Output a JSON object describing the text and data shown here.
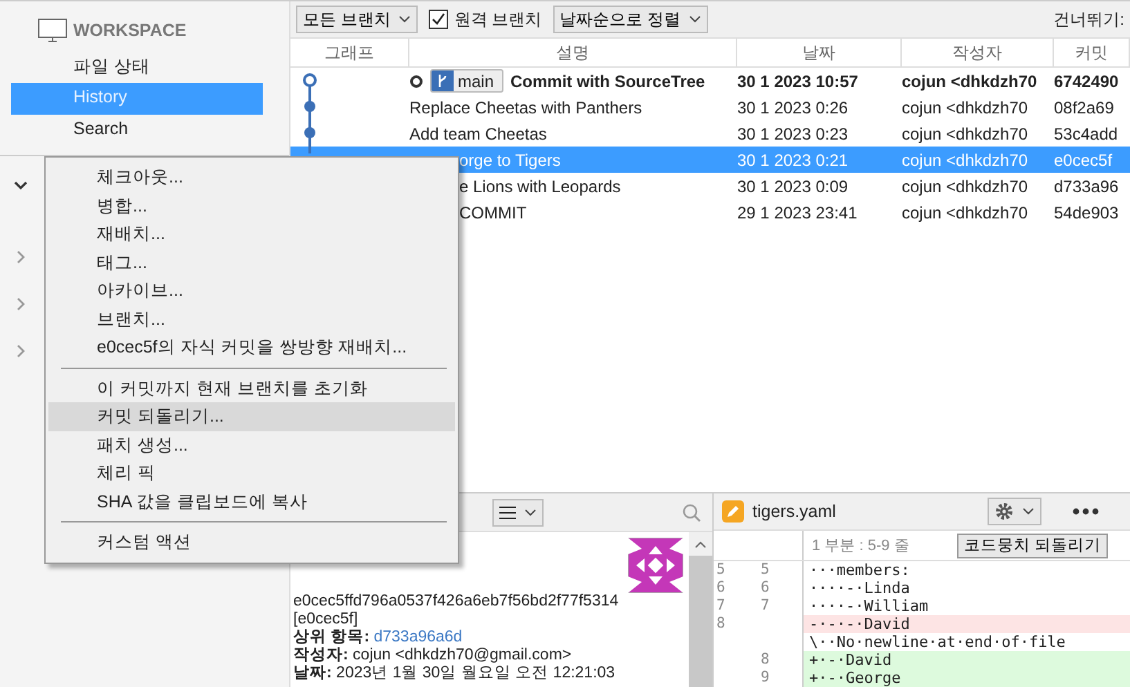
{
  "sidebar": {
    "workspace_title": "WORKSPACE",
    "items": [
      {
        "label": "파일 상태",
        "selected": false
      },
      {
        "label": "History",
        "selected": true
      },
      {
        "label": "Search",
        "selected": false
      }
    ],
    "collapsed_sections": [
      {
        "expanded": true
      },
      {
        "expanded": false
      },
      {
        "expanded": false
      },
      {
        "expanded": false
      }
    ]
  },
  "toolbar": {
    "branch_filter": "모든 브랜치",
    "remote_branches": {
      "label": "원격 브랜치",
      "checked": true
    },
    "sort": "날짜순으로 정렬",
    "jump_label": "건너뛰기:"
  },
  "table": {
    "columns": [
      "그래프",
      "설명",
      "날짜",
      "작성자",
      "커밋"
    ],
    "rows": [
      {
        "description": "Commit with SourceTree",
        "branch": "main",
        "date": "30 1 2023 10:57",
        "author": "cojun <dhkdzh70",
        "commit": "6742490",
        "head": true,
        "selected": false
      },
      {
        "description": "Replace Cheetas with Panthers",
        "date": "30 1 2023 0:26",
        "author": "cojun <dhkdzh70",
        "commit": "08f2a69",
        "head": false,
        "selected": false
      },
      {
        "description": "Add team Cheetas",
        "date": "30 1 2023 0:23",
        "author": "cojun <dhkdzh70",
        "commit": "53c4add",
        "head": false,
        "selected": false
      },
      {
        "description": "orge to Tigers",
        "date": "30 1 2023 0:21",
        "author": "cojun <dhkdzh70",
        "commit": "e0cec5f",
        "head": false,
        "selected": true
      },
      {
        "description": "e Lions with Leopards",
        "date": "30 1 2023 0:09",
        "author": "cojun <dhkdzh70",
        "commit": "d733a96",
        "head": false,
        "selected": false
      },
      {
        "description": "COMMIT",
        "date": "29 1 2023 23:41",
        "author": "cojun <dhkdzh70",
        "commit": "54de903",
        "head": false,
        "selected": false
      }
    ]
  },
  "context_menu": [
    {
      "kind": "item",
      "label": "체크아웃...",
      "selected": false
    },
    {
      "kind": "item",
      "label": "병합...",
      "selected": false
    },
    {
      "kind": "item",
      "label": "재배치...",
      "selected": false
    },
    {
      "kind": "item",
      "label": "태그...",
      "selected": false
    },
    {
      "kind": "item",
      "label": "아카이브...",
      "selected": false
    },
    {
      "kind": "item",
      "label": "브랜치...",
      "selected": false
    },
    {
      "kind": "item",
      "label": "e0cec5f의 자식 커밋을 쌍방향 재배치...",
      "selected": false
    },
    {
      "kind": "separator"
    },
    {
      "kind": "item",
      "label": "이 커밋까지 현재 브랜치를 초기화",
      "selected": false
    },
    {
      "kind": "item",
      "label": "커밋 되돌리기...",
      "selected": true
    },
    {
      "kind": "item",
      "label": "패치 생성...",
      "selected": false
    },
    {
      "kind": "item",
      "label": "체리 픽",
      "selected": false
    },
    {
      "kind": "item",
      "label": "SHA 값을 클립보드에 복사",
      "selected": false
    },
    {
      "kind": "separator"
    },
    {
      "kind": "item",
      "label": "커스텀 액션",
      "selected": false
    }
  ],
  "commit_details": {
    "sha": "e0cec5ffd796a0537f426a6eb7f56bd2f77f5314",
    "short_sha": "[e0cec5f]",
    "fields": [
      {
        "label": "상위 항목:",
        "value": "d733a96a6d",
        "kind": "link"
      },
      {
        "label": "작성자:",
        "value": "cojun <dhkdzh70@gmail.com>",
        "kind": "text"
      },
      {
        "label": "날짜:",
        "value": "2023년 1월 30일 월요일 오전 12:21:03",
        "kind": "text"
      }
    ]
  },
  "diff": {
    "file_name": "tigers.yaml",
    "hunk_header": "1 부분 : 5-9 줄",
    "discard_hunk_button": "코드뭉치 되돌리기",
    "lines": [
      {
        "old": "5",
        "new": "5",
        "text": "···members:",
        "kind": "context"
      },
      {
        "old": "6",
        "new": "6",
        "text": "····-·Linda",
        "kind": "context"
      },
      {
        "old": "7",
        "new": "7",
        "text": "····-·William",
        "kind": "context"
      },
      {
        "old": "8",
        "text": "-·-·-·David",
        "kind": "removed"
      },
      {
        "text": "\\··No·newline·at·end·of·file",
        "kind": "context"
      },
      {
        "new": "8",
        "text": "+·-·David",
        "kind": "added"
      },
      {
        "new": "9",
        "text": "+·-·George",
        "kind": "added"
      }
    ]
  }
}
